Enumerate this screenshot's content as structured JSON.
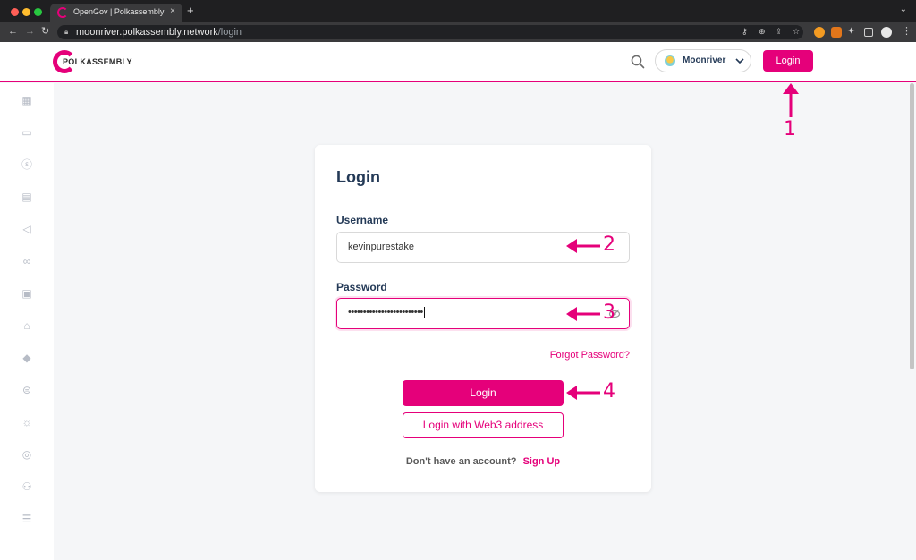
{
  "browser": {
    "tab_title": "OpenGov | Polkassembly",
    "tab_close": "×",
    "new_tab": "+",
    "tabs_menu": "⌄",
    "url_host": "moonriver.polkassembly.network",
    "url_path": "/login"
  },
  "header": {
    "logo_text": "POLKASSEMBLY",
    "network_label": "Moonriver",
    "login_button": "Login"
  },
  "form": {
    "title": "Login",
    "username_label": "Username",
    "username_value": "kevinpurestake",
    "password_label": "Password",
    "password_value": "•••••••••••••••••••••••••",
    "forgot_link": "Forgot Password?",
    "login_button": "Login",
    "web3_button": "Login with Web3 address",
    "signup_question": "Don't have an account?",
    "signup_link": "Sign Up"
  },
  "annotations": [
    "1",
    "2",
    "3",
    "4"
  ],
  "colors": {
    "accent": "#e5007a",
    "text_dark": "#243a57",
    "background": "#f5f6f8"
  },
  "sidebar_icons": [
    "grid-icon",
    "discussions-icon",
    "treasury-icon",
    "calendar-icon",
    "megaphone-icon",
    "link-icon",
    "document-icon",
    "tech-committee-icon",
    "shield-icon",
    "dollar-icon",
    "sun-icon",
    "circle-icon",
    "members-icon",
    "list-icon"
  ]
}
